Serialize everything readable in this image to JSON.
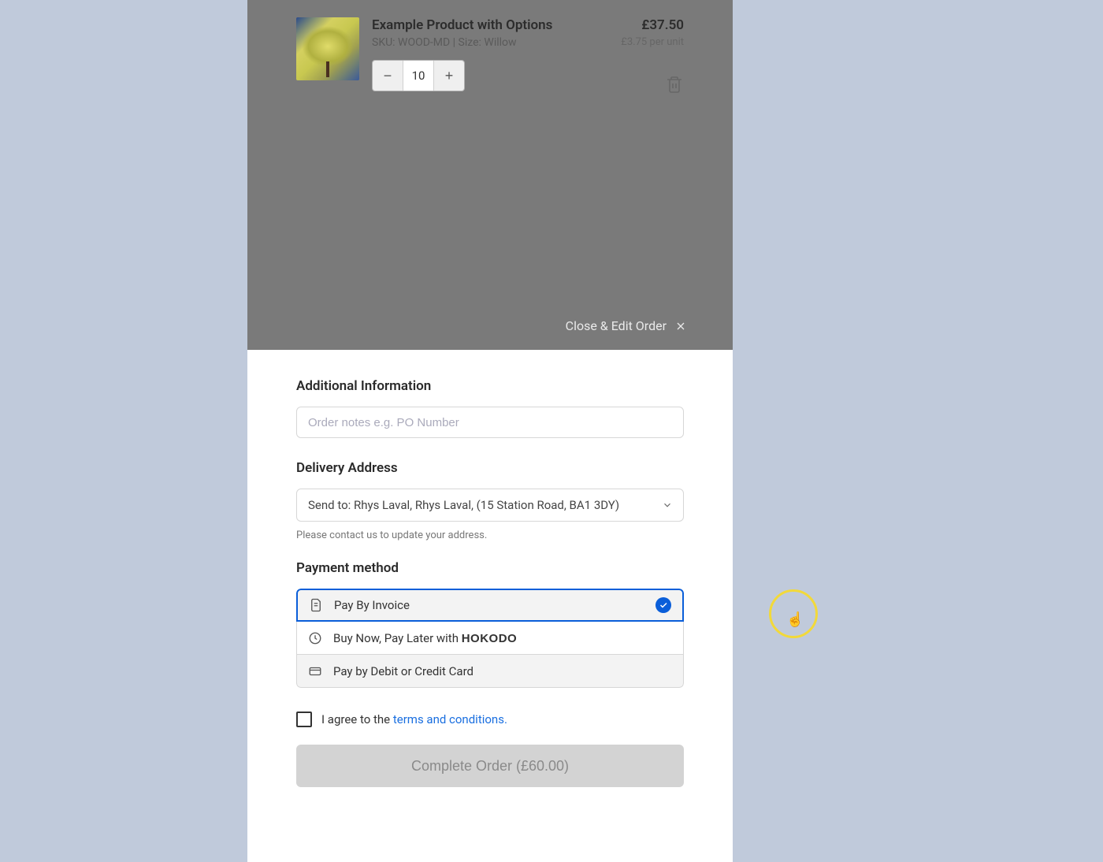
{
  "cart": {
    "items": [
      {
        "title": "Example Product with Options",
        "sku_line": "SKU: WOOD-MD | Size: Willow",
        "quantity": "10",
        "line_price": "£37.50",
        "unit_price": "£3.75 per unit"
      }
    ]
  },
  "close_edit_label": "Close & Edit Order",
  "sheet": {
    "additional_info_title": "Additional Information",
    "order_notes_placeholder": "Order notes e.g. PO Number",
    "delivery_title": "Delivery Address",
    "delivery_selected": "Send to: Rhys Laval, Rhys Laval, (15 Station Road, BA1 3DY)",
    "delivery_helper": "Please contact us to update your address.",
    "payment_title": "Payment method",
    "payment_options": {
      "invoice": "Pay By Invoice",
      "bnpl_prefix": "Buy Now, Pay Later with ",
      "bnpl_provider": "HOKODO",
      "card": "Pay by Debit or Credit Card"
    },
    "terms_prefix": "I agree to the ",
    "terms_link": "terms and conditions.",
    "complete_label": "Complete Order (£60.00)"
  }
}
